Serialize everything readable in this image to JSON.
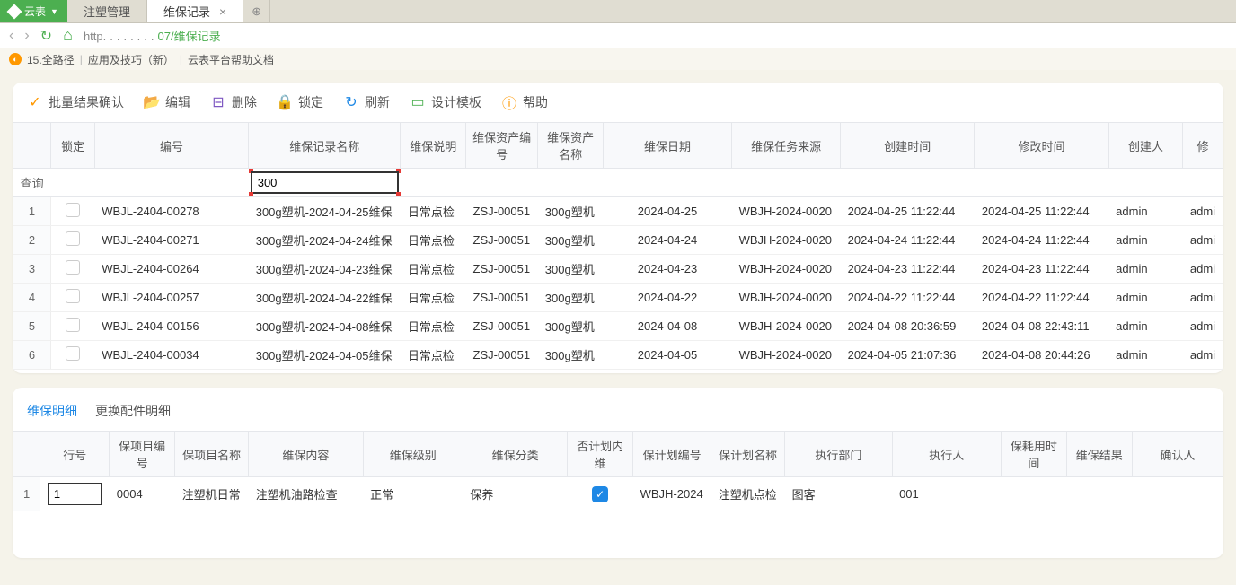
{
  "tabs": {
    "app": "云表",
    "items": [
      "注塑管理",
      "维保记录"
    ],
    "active_index": 1
  },
  "address": {
    "prefix": "http",
    "suffix": "07/维保记录"
  },
  "breadcrumb": {
    "items": [
      "15.全路径",
      "应用及技巧（新）",
      "云表平台帮助文档"
    ]
  },
  "toolbar": {
    "confirm": "批量结果确认",
    "edit": "编辑",
    "delete": "删除",
    "lock": "锁定",
    "refresh": "刷新",
    "template": "设计模板",
    "help": "帮助"
  },
  "main_headers": {
    "lock": "锁定",
    "code": "编号",
    "name": "维保记录名称",
    "desc": "维保说明",
    "asset_code": "维保资产编号",
    "asset_name": "维保资产名称",
    "date": "维保日期",
    "source": "维保任务来源",
    "create_time": "创建时间",
    "modify_time": "修改时间",
    "creator": "创建人",
    "modifier": "修"
  },
  "filter": {
    "label": "查询",
    "name_value": "300"
  },
  "rows": [
    {
      "n": "1",
      "code": "WBJL-2404-00278",
      "name": "300g塑机-2024-04-25维保",
      "desc": "日常点检",
      "asset_code": "ZSJ-00051",
      "asset_name": "300g塑机",
      "date": "2024-04-25",
      "source": "WBJH-2024-0020",
      "ct": "2024-04-25 11:22:44",
      "mt": "2024-04-25 11:22:44",
      "creator": "admin",
      "modifier": "admi"
    },
    {
      "n": "2",
      "code": "WBJL-2404-00271",
      "name": "300g塑机-2024-04-24维保",
      "desc": "日常点检",
      "asset_code": "ZSJ-00051",
      "asset_name": "300g塑机",
      "date": "2024-04-24",
      "source": "WBJH-2024-0020",
      "ct": "2024-04-24 11:22:44",
      "mt": "2024-04-24 11:22:44",
      "creator": "admin",
      "modifier": "admi"
    },
    {
      "n": "3",
      "code": "WBJL-2404-00264",
      "name": "300g塑机-2024-04-23维保",
      "desc": "日常点检",
      "asset_code": "ZSJ-00051",
      "asset_name": "300g塑机",
      "date": "2024-04-23",
      "source": "WBJH-2024-0020",
      "ct": "2024-04-23 11:22:44",
      "mt": "2024-04-23 11:22:44",
      "creator": "admin",
      "modifier": "admi"
    },
    {
      "n": "4",
      "code": "WBJL-2404-00257",
      "name": "300g塑机-2024-04-22维保",
      "desc": "日常点检",
      "asset_code": "ZSJ-00051",
      "asset_name": "300g塑机",
      "date": "2024-04-22",
      "source": "WBJH-2024-0020",
      "ct": "2024-04-22 11:22:44",
      "mt": "2024-04-22 11:22:44",
      "creator": "admin",
      "modifier": "admi"
    },
    {
      "n": "5",
      "code": "WBJL-2404-00156",
      "name": "300g塑机-2024-04-08维保",
      "desc": "日常点检",
      "asset_code": "ZSJ-00051",
      "asset_name": "300g塑机",
      "date": "2024-04-08",
      "source": "WBJH-2024-0020",
      "ct": "2024-04-08 20:36:59",
      "mt": "2024-04-08 22:43:11",
      "creator": "admin",
      "modifier": "admi"
    },
    {
      "n": "6",
      "code": "WBJL-2404-00034",
      "name": "300g塑机-2024-04-05维保",
      "desc": "日常点检",
      "asset_code": "ZSJ-00051",
      "asset_name": "300g塑机",
      "date": "2024-04-05",
      "source": "WBJH-2024-0020",
      "ct": "2024-04-05 21:07:36",
      "mt": "2024-04-08 20:44:26",
      "creator": "admin",
      "modifier": "admi"
    }
  ],
  "sub_tabs": {
    "detail": "维保明细",
    "parts": "更换配件明细"
  },
  "detail_headers": {
    "rownum": "行号",
    "item_code": "保项目编号",
    "item_name": "保项目名称",
    "content": "维保内容",
    "level": "维保级别",
    "category": "维保分类",
    "planned": "否计划内维",
    "plan_code": "保计划编号",
    "plan_name": "保计划名称",
    "dept": "执行部门",
    "executor": "执行人",
    "time": "保耗用时间",
    "result": "维保结果",
    "confirm": "确认人"
  },
  "detail_row": {
    "n": "1",
    "rownum": "1",
    "item_code": "0004",
    "item_name": "注塑机日常",
    "content": "注塑机油路检查",
    "level": "正常",
    "category": "保养",
    "plan_code": "WBJH-2024",
    "plan_name": "注塑机点检",
    "dept": "图客",
    "executor": "001"
  }
}
